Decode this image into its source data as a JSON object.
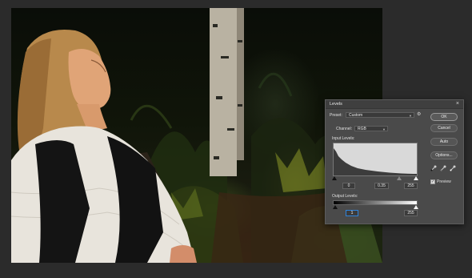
{
  "dialog": {
    "title": "Levels",
    "close_glyph": "×",
    "preset_label": "Preset:",
    "preset_value": "Custom",
    "channel_label": "Channel:",
    "channel_value": "RGB",
    "input_levels_label": "Input Levels:",
    "input_black": "0",
    "input_gamma": "0.35",
    "input_white": "255",
    "output_levels_label": "Output Levels:",
    "output_black": "1",
    "output_white": "255",
    "buttons": {
      "ok": "OK",
      "cancel": "Cancel",
      "auto": "Auto",
      "options": "Options..."
    },
    "preview_label": "Preview",
    "preview_checked": true,
    "icons": {
      "gear": "gear-icon",
      "black_eyedropper": "black-eyedropper-icon",
      "gray_eyedropper": "gray-eyedropper-icon",
      "white_eyedropper": "white-eyedropper-icon"
    }
  }
}
